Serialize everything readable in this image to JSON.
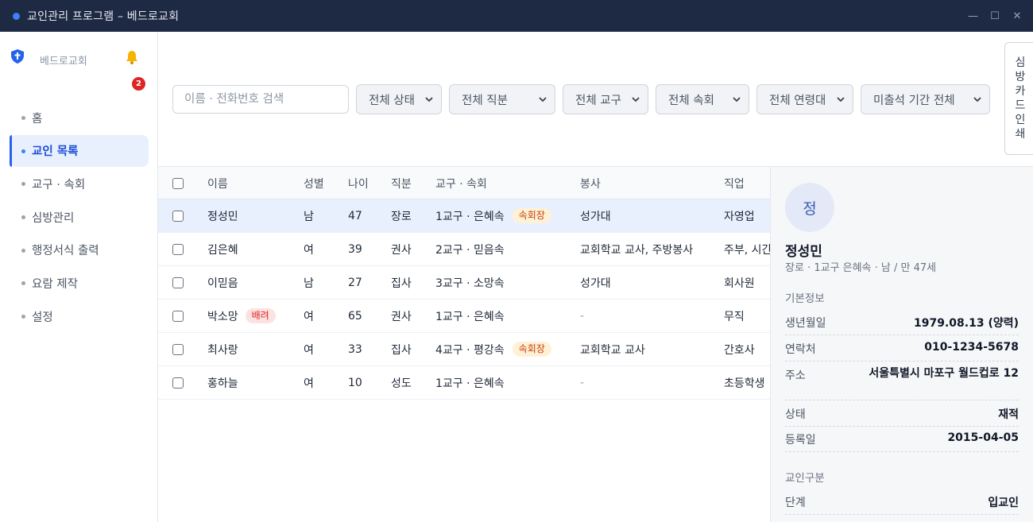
{
  "window": {
    "title": "교인관리 프로그램 – 베드로교회",
    "controls": [
      "—",
      "☐",
      "✕"
    ]
  },
  "sidebar": {
    "church_name": "베드로교회",
    "notification_count": "2",
    "items": [
      {
        "label": "홈",
        "active": false
      },
      {
        "label": "교인 목록",
        "active": true
      },
      {
        "label": "교구 · 속회",
        "active": false
      },
      {
        "label": "심방관리",
        "active": false
      },
      {
        "label": "행정서식 출력",
        "active": false
      },
      {
        "label": "요람 제작",
        "active": false
      },
      {
        "label": "설정",
        "active": false
      }
    ]
  },
  "toolbar": {
    "search_placeholder": "이름 · 전화번호 검색",
    "filters": [
      "전체 상태",
      "전체 직분",
      "전체 교구",
      "전체 속회",
      "전체 연령대",
      "미출석 기간 전체"
    ],
    "print_chars": [
      "심",
      "방",
      "카",
      "드",
      "인",
      "쇄"
    ]
  },
  "table": {
    "headers": {
      "name": "이름",
      "gender": "성별",
      "age": "나이",
      "title": "직분",
      "district": "교구 · 속회",
      "service": "봉사",
      "job": "직업"
    },
    "rows": [
      {
        "name": "정성민",
        "name_tag": "",
        "gender": "남",
        "age": "47",
        "title": "장로",
        "district": "1교구 · 은혜속",
        "district_tag": "속회장",
        "service": "성가대",
        "job": "자영업",
        "selected": true
      },
      {
        "name": "김은혜",
        "name_tag": "",
        "gender": "여",
        "age": "39",
        "title": "권사",
        "district": "2교구 · 믿음속",
        "district_tag": "",
        "service": "교회학교 교사, 주방봉사",
        "job": "주부, 시간",
        "selected": false
      },
      {
        "name": "이믿음",
        "name_tag": "",
        "gender": "남",
        "age": "27",
        "title": "집사",
        "district": "3교구 · 소망속",
        "district_tag": "",
        "service": "성가대",
        "job": "회사원",
        "selected": false
      },
      {
        "name": "박소망",
        "name_tag": "배려",
        "gender": "여",
        "age": "65",
        "title": "권사",
        "district": "1교구 · 은혜속",
        "district_tag": "",
        "service": "-",
        "job": "무직",
        "selected": false
      },
      {
        "name": "최사랑",
        "name_tag": "",
        "gender": "여",
        "age": "33",
        "title": "집사",
        "district": "4교구 · 평강속",
        "district_tag": "속회장",
        "service": "교회학교 교사",
        "job": "간호사",
        "selected": false
      },
      {
        "name": "홍하늘",
        "name_tag": "",
        "gender": "여",
        "age": "10",
        "title": "성도",
        "district": "1교구 · 은혜속",
        "district_tag": "",
        "service": "-",
        "job": "초등학생",
        "selected": false
      }
    ]
  },
  "detail": {
    "avatar_initial": "정",
    "name": "정성민",
    "subtitle": "장로 · 1교구 은혜속 · 남 / 만 47세",
    "basic_section": "기본정보",
    "basic": [
      {
        "key": "생년월일",
        "value": "1979.08.13 (양력)"
      },
      {
        "key": "연락처",
        "value": "010-1234-5678"
      },
      {
        "key": "주소",
        "value": "서울특별시 마포구 월드컵로 12"
      },
      {
        "key": "상태",
        "value": "재적"
      },
      {
        "key": "등록일",
        "value": "2015-04-05"
      }
    ],
    "category_section": "교인구분",
    "category": [
      {
        "key": "단계",
        "value": "입교인"
      }
    ]
  },
  "colors": {
    "titlebar": "#1e2a44",
    "accent": "#2563eb",
    "selected_row": "#e8f0fe",
    "badge": "#dc2626",
    "tag_orange": "#fff1d6",
    "tag_red": "#fde2e2"
  },
  "icons": [
    "shield-cross-icon",
    "bell-icon",
    "chevron-down-icon"
  ]
}
